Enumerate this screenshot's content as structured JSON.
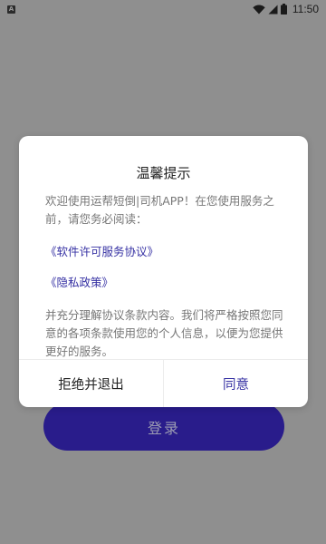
{
  "status_bar": {
    "notification_icon": "A",
    "time": "11:50",
    "icons": [
      "wifi-icon",
      "signal-icon",
      "battery-icon"
    ]
  },
  "login": {
    "label": "登录"
  },
  "dialog": {
    "title": "温馨提示",
    "intro": "欢迎使用运帮短倒|司机APP！在您使用服务之前，请您务必阅读：",
    "links": [
      "《软件许可服务协议》",
      "《隐私政策》"
    ],
    "notice": "并充分理解协议条款内容。我们将严格按照您同意的各项条款使用您的个人信息，以便为您提供更好的服务。",
    "decline_label": "拒绝并退出",
    "agree_label": "同意"
  },
  "colors": {
    "overlay": "#8f8f8f",
    "accent": "#3530a3",
    "login_button": "#291c8b"
  }
}
